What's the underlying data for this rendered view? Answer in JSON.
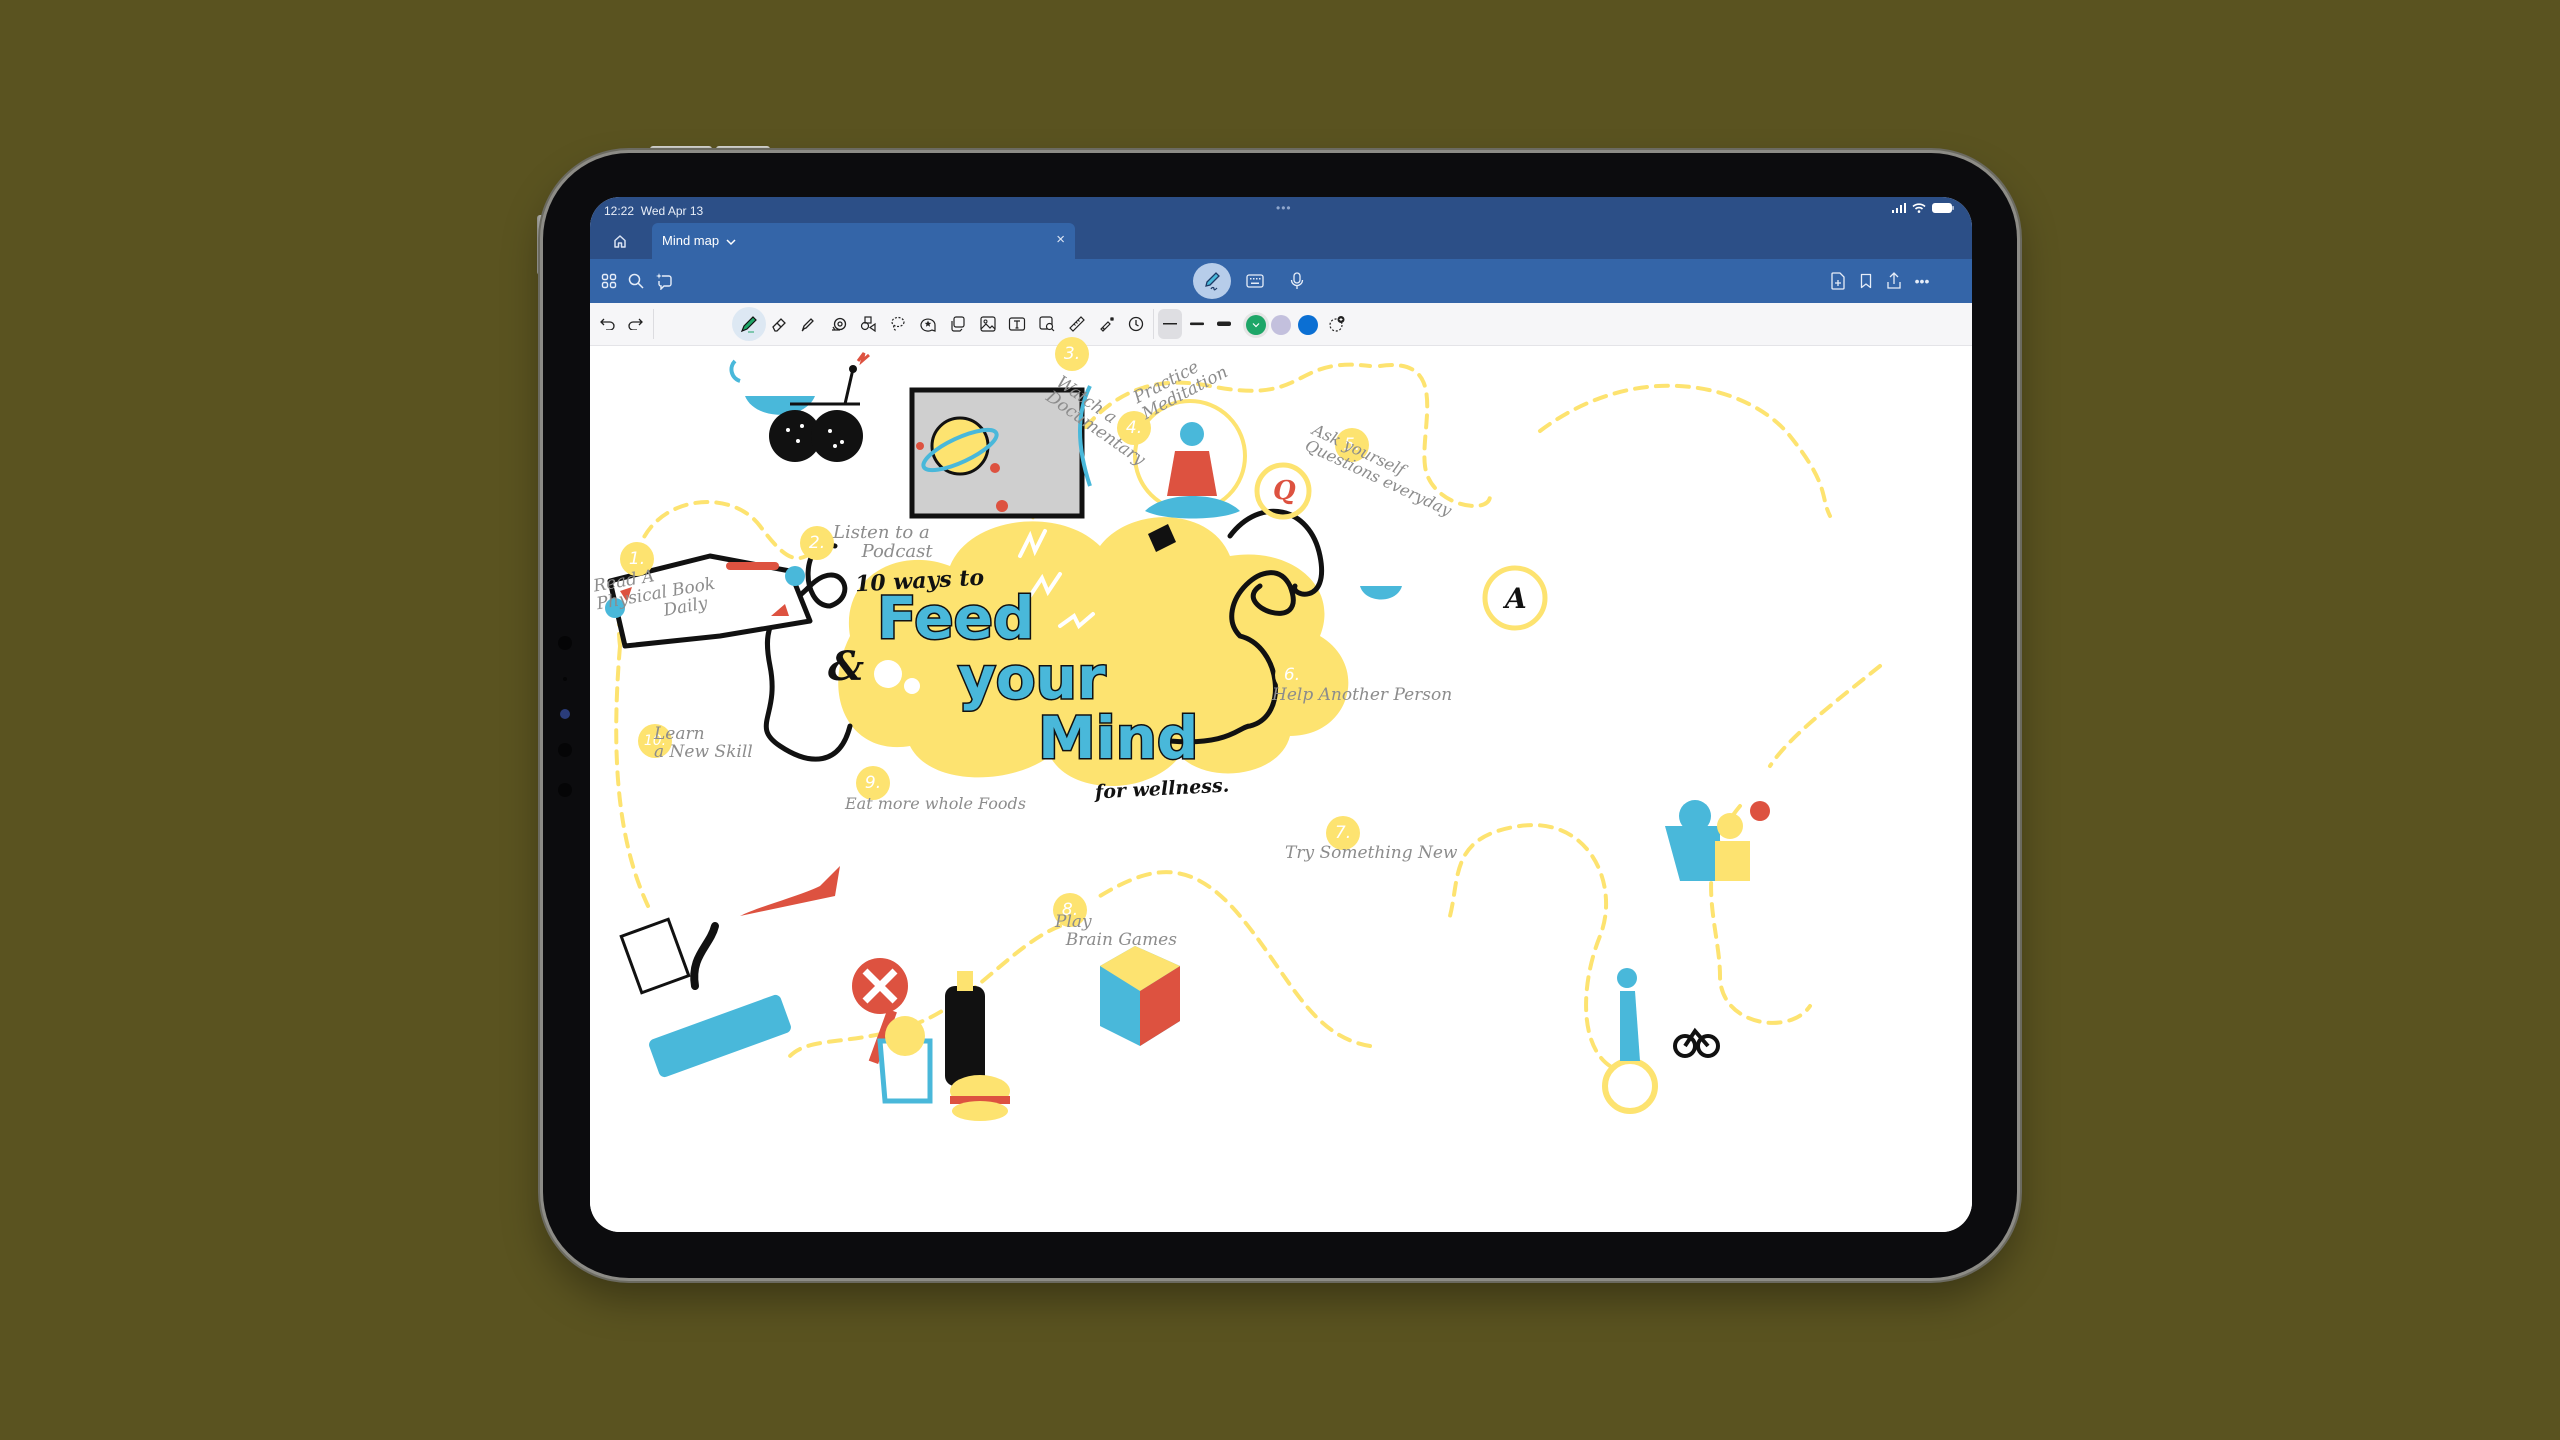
{
  "status_bar": {
    "time": "12:22",
    "date": "Wed Apr 13",
    "multitask_dots": "•••",
    "signal_icon": "cellular-signal-icon",
    "wifi_icon": "wifi-icon",
    "battery_icon": "battery-icon"
  },
  "tabs": {
    "home_icon": "home-icon",
    "items": [
      {
        "label": "Mind map",
        "chevron": "chevron-down-icon",
        "close": "×"
      }
    ]
  },
  "app_toolbar": {
    "left": [
      "grid-view-icon",
      "search-icon",
      "ai-assistant-icon"
    ],
    "center": [
      "pen-mode-icon",
      "keyboard-icon",
      "microphone-icon"
    ],
    "right": [
      "add-page-icon",
      "bookmark-icon",
      "share-icon",
      "more-icon"
    ],
    "more_label": "•••"
  },
  "draw_toolbar": {
    "history": [
      "undo-icon",
      "redo-icon"
    ],
    "tools": [
      "pen-icon",
      "eraser-icon",
      "highlighter-icon",
      "tape-icon",
      "shapes-icon",
      "lasso-icon",
      "sticker-icon",
      "pages-icon",
      "image-icon",
      "text-box-icon",
      "image-search-icon",
      "ruler-icon",
      "laser-pointer-icon",
      "clock-icon"
    ],
    "active_tool": "pen-icon",
    "stroke_widths": [
      "thin",
      "medium",
      "thick"
    ],
    "selected_width": "thin",
    "colors": [
      {
        "name": "green",
        "hex": "#1ea668",
        "selected": true
      },
      {
        "name": "lavender",
        "hex": "#c3c0dd",
        "selected": false
      },
      {
        "name": "blue",
        "hex": "#0b6fd3",
        "selected": false
      }
    ],
    "add_color_icon": "add-color-icon"
  },
  "canvas": {
    "title_small": "10 ways to",
    "title_words": [
      "Feed",
      "your",
      "Mind"
    ],
    "subtitle": "for wellness.",
    "ampersand": "&",
    "steps": [
      {
        "number": "1.",
        "label": "Read A\nPhysical Book\n            Daily"
      },
      {
        "number": "2.",
        "label": "Listen to a\n     Podcast"
      },
      {
        "number": "3.",
        "label": "Watch a\nDocumentary"
      },
      {
        "number": "4.",
        "label": "Practice\nMeditation"
      },
      {
        "number": "5.",
        "label": "Ask yourself\nQuestions everyday"
      },
      {
        "number": "6.",
        "label": "Help Another Person"
      },
      {
        "number": "7.",
        "label": "Try Something New"
      },
      {
        "number": "8.",
        "label": "Play\n  Brain Games"
      },
      {
        "number": "9.",
        "label": "Eat more whole Foods"
      },
      {
        "number": "10.",
        "label": "Learn\na New Skill"
      }
    ],
    "q_letter": "Q",
    "a_letter": "A",
    "palette": {
      "yellow": "#fde370",
      "cyan": "#49b8da",
      "red": "#dd5240",
      "ink": "#111111",
      "grey": "#8c8c8c"
    }
  }
}
